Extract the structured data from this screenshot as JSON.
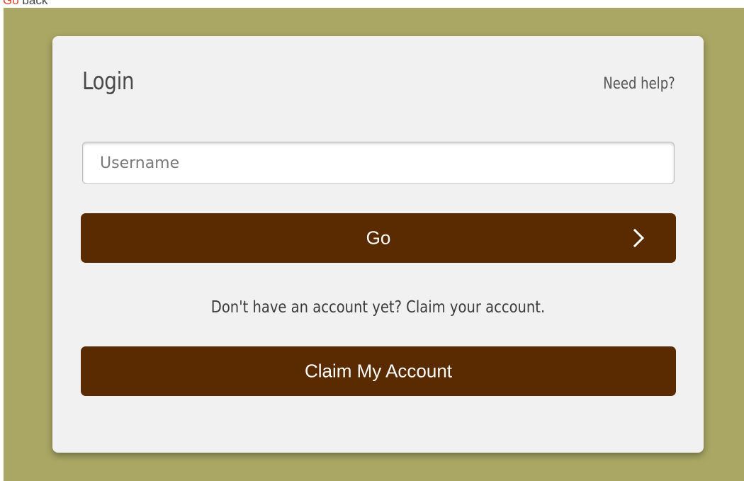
{
  "top_strip": {
    "text_accent": "Go",
    "text_rest": "back"
  },
  "login": {
    "title": "Login",
    "help_link": "Need help?",
    "username_placeholder": "Username",
    "go_button_label": "Go",
    "account_prompt": "Don't have an account yet? Claim your account.",
    "claim_button_label": "Claim My Account"
  },
  "icons": {
    "go_button_icon": "chevron-right-icon"
  },
  "colors": {
    "page_background": "#aaa764",
    "card_background": "#f1f1f1",
    "button_background": "#5a2a00",
    "button_text": "#ffffff",
    "accent_text": "#d9452b"
  }
}
